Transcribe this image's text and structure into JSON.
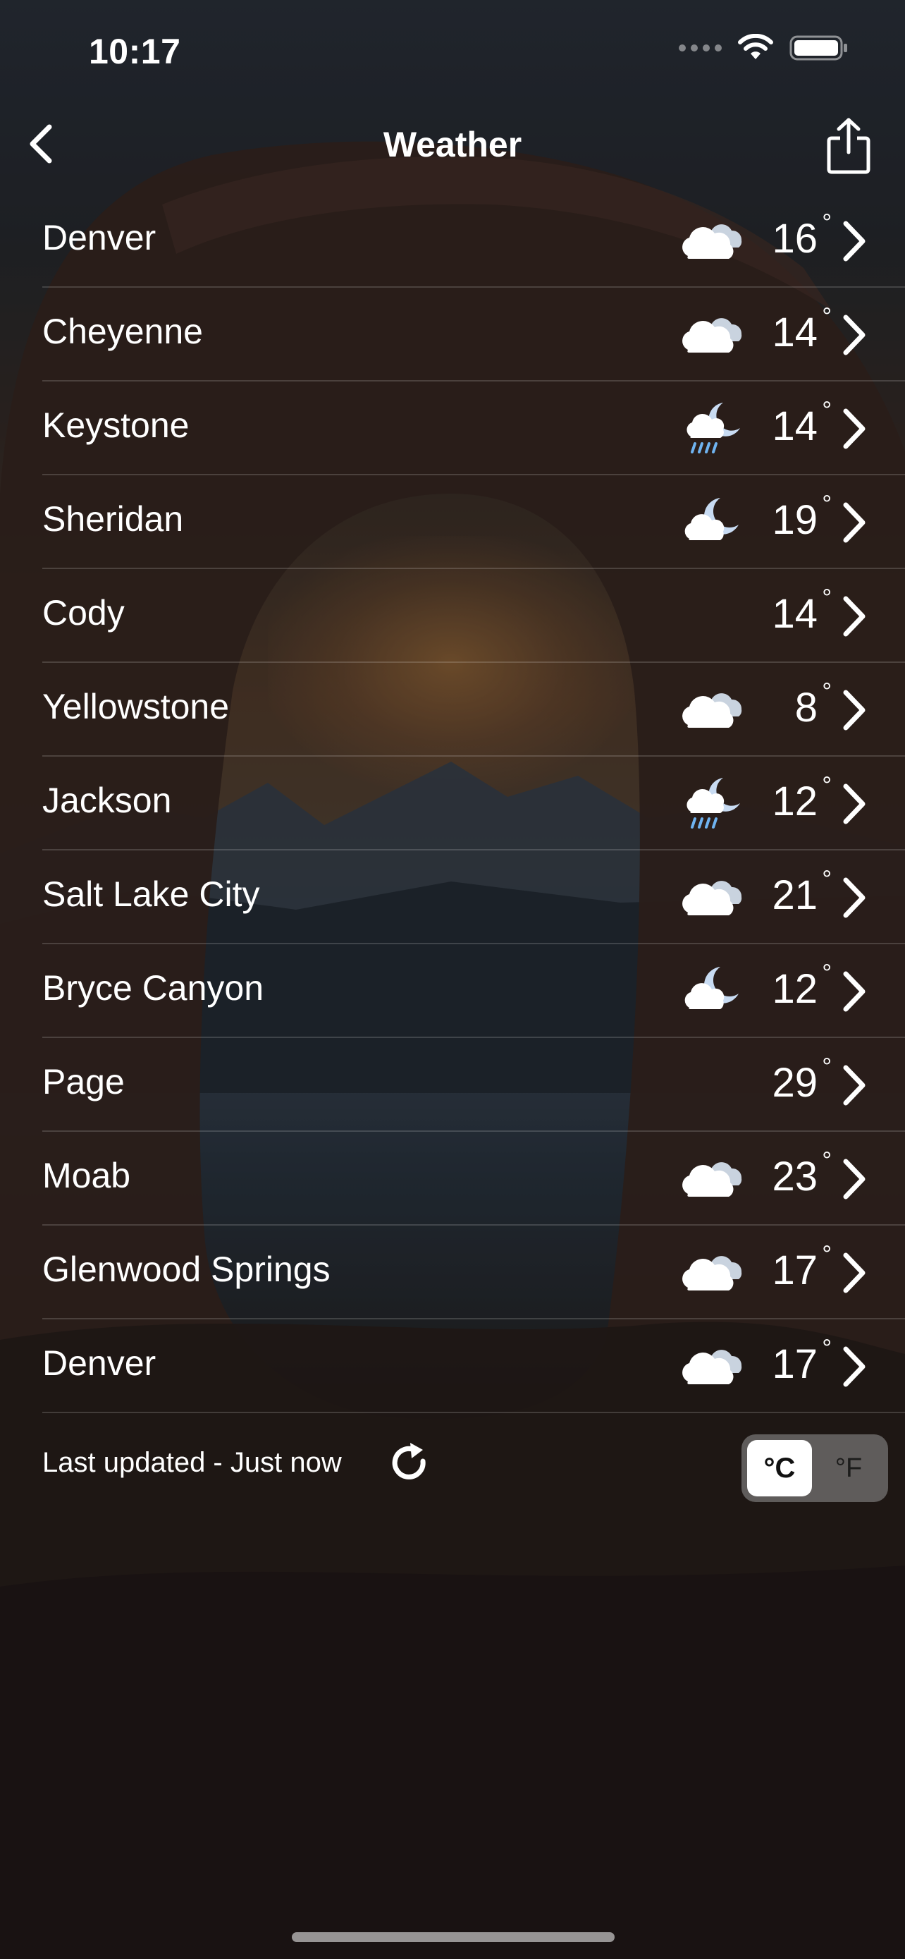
{
  "status_bar": {
    "time": "10:17"
  },
  "nav": {
    "title": "Weather"
  },
  "cities": [
    {
      "name": "Denver",
      "condition": "cloudy-icon",
      "temp": "16",
      "unit_mark": "°"
    },
    {
      "name": "Cheyenne",
      "condition": "cloudy-icon",
      "temp": "14",
      "unit_mark": "°"
    },
    {
      "name": "Keystone",
      "condition": "moon-rain-icon",
      "temp": "14",
      "unit_mark": "°"
    },
    {
      "name": "Sheridan",
      "condition": "moon-cloud-icon",
      "temp": "19",
      "unit_mark": "°"
    },
    {
      "name": "Cody",
      "condition": "moon-icon",
      "temp": "14",
      "unit_mark": "°"
    },
    {
      "name": "Yellowstone",
      "condition": "cloudy-icon",
      "temp": "8",
      "unit_mark": "°"
    },
    {
      "name": "Jackson",
      "condition": "moon-rain-icon",
      "temp": "12",
      "unit_mark": "°"
    },
    {
      "name": "Salt Lake City",
      "condition": "cloudy-icon",
      "temp": "21",
      "unit_mark": "°"
    },
    {
      "name": "Bryce Canyon",
      "condition": "moon-cloud-icon",
      "temp": "12",
      "unit_mark": "°"
    },
    {
      "name": "Page",
      "condition": "moon-icon",
      "temp": "29",
      "unit_mark": "°"
    },
    {
      "name": "Moab",
      "condition": "cloudy-icon",
      "temp": "23",
      "unit_mark": "°"
    },
    {
      "name": "Glenwood Springs",
      "condition": "cloudy-icon",
      "temp": "17",
      "unit_mark": "°"
    },
    {
      "name": "Denver",
      "condition": "cloudy-icon",
      "temp": "17",
      "unit_mark": "°"
    }
  ],
  "footer": {
    "last_updated": "Last updated - Just now",
    "unit_celsius": "°C",
    "unit_fahrenheit": "°F",
    "selected_unit": "°C"
  },
  "colors": {
    "text": "#ffffff",
    "icon_moon": "#c8dbf2",
    "icon_rain": "#6fb3f0",
    "toggle_selected": "#ffffff"
  }
}
